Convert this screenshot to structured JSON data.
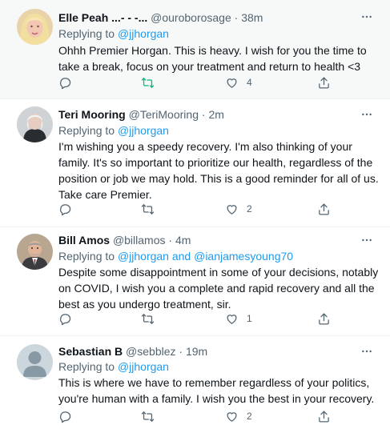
{
  "tweets": [
    {
      "name": "Elle Peah ...- - -...",
      "handle": "@ouroborosage",
      "time": "38m",
      "replying_prefix": "Replying to",
      "replying_to": "@jjhorgan",
      "text": "Ohhh Premier Horgan. This is heavy. I wish for you the time to take a break, focus on your treatment and return to health <3",
      "retweet_active": true,
      "likes": "4"
    },
    {
      "name": "Teri Mooring",
      "handle": "@TeriMooring",
      "time": "2m",
      "replying_prefix": "Replying to",
      "replying_to": "@jjhorgan",
      "text": "I'm wishing you a speedy recovery. I'm also thinking of your family. It's so important to prioritize our health, regardless of the position or job we may hold. This is a good reminder for all of us. Take care Premier.",
      "likes": "2"
    },
    {
      "name": "Bill Amos",
      "handle": "@billamos",
      "time": "4m",
      "replying_prefix": "Replying to",
      "replying_to": "@jjhorgan and @ianjamesyoung70",
      "text": "Despite some disappointment in some of your decisions, notably on COVID, I wish you a complete and rapid recovery and all the best as you undergo treatment, sir.",
      "likes": "1"
    },
    {
      "name": "Sebastian B",
      "handle": "@sebblez",
      "time": "19m",
      "replying_prefix": "Replying to",
      "replying_to": "@jjhorgan",
      "text": "This is where we have to remember regardless of your politics, you're human with a family.  I wish you the best in your recovery.",
      "likes": "2"
    }
  ],
  "colors": {
    "link": "#1d9bf0",
    "secondary": "#536471",
    "retweet_active": "#00ba7c",
    "highlight_bg": "#f7f9f9"
  },
  "icons": [
    "more-icon",
    "reply-icon",
    "retweet-icon",
    "like-icon",
    "share-icon"
  ]
}
